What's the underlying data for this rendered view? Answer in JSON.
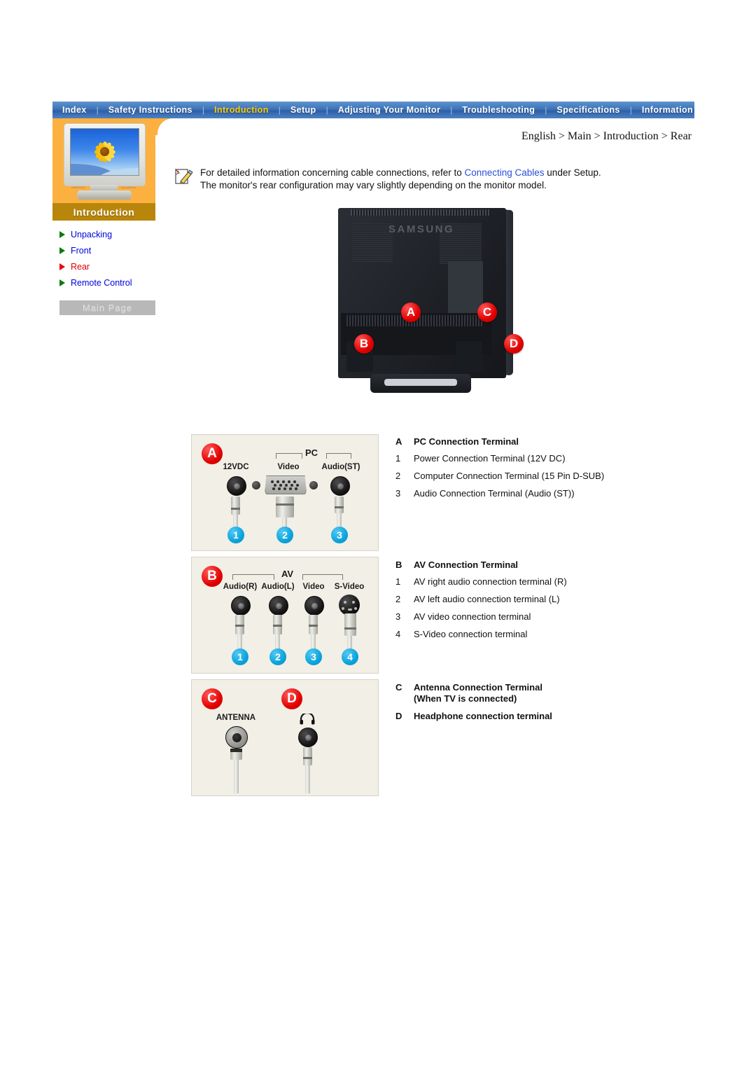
{
  "nav": {
    "items": [
      {
        "label": "Index",
        "active": false
      },
      {
        "label": "Safety Instructions",
        "active": false
      },
      {
        "label": "Introduction",
        "active": true
      },
      {
        "label": "Setup",
        "active": false
      },
      {
        "label": "Adjusting Your Monitor",
        "active": false
      },
      {
        "label": "Troubleshooting",
        "active": false
      },
      {
        "label": "Specifications",
        "active": false
      },
      {
        "label": "Information",
        "active": false
      }
    ],
    "separator": "|"
  },
  "sidebar": {
    "title": "Introduction",
    "thumbnail_brand": "SAMSUNG",
    "thumbnail_model": "SyncMaster",
    "items": [
      {
        "label": "Unpacking",
        "current": false
      },
      {
        "label": "Front",
        "current": false
      },
      {
        "label": "Rear",
        "current": true
      },
      {
        "label": "Remote Control",
        "current": false
      }
    ],
    "main_page_button": "Main Page"
  },
  "breadcrumb": "English > Main > Introduction > Rear",
  "note": {
    "line1_before": "For detailed information concerning cable connections, refer to ",
    "line1_link": "Connecting Cables",
    "line1_after": " under Setup.",
    "line2": "The monitor's rear configuration may vary slightly depending on the monitor model."
  },
  "monitor_photo": {
    "brand": "SAMSUNG",
    "markers": [
      "A",
      "B",
      "C",
      "D"
    ]
  },
  "panels": [
    {
      "id": "A",
      "marker": "A",
      "group_label": "PC",
      "jacks": [
        "12VDC",
        "Video",
        "Audio(ST)"
      ],
      "numbers": [
        "1",
        "2",
        "3"
      ]
    },
    {
      "id": "B",
      "marker": "B",
      "group_label": "AV",
      "jacks": [
        "Audio(R)",
        "Audio(L)",
        "Video",
        "S-Video"
      ],
      "numbers": [
        "1",
        "2",
        "3",
        "4"
      ]
    },
    {
      "id": "C",
      "markers": [
        "C",
        "D"
      ],
      "jacks": [
        "ANTENNA"
      ],
      "headphone_icon": "headphone-icon"
    }
  ],
  "descriptions": {
    "A": {
      "key": "A",
      "title": "PC Connection Terminal",
      "rows": [
        {
          "k": "1",
          "t": "Power Connection Terminal (12V DC)"
        },
        {
          "k": "2",
          "t": "Computer Connection Terminal (15 Pin D-SUB)"
        },
        {
          "k": "3",
          "t": "Audio Connection Terminal (Audio (ST))"
        }
      ]
    },
    "B": {
      "key": "B",
      "title": "AV Connection Terminal",
      "rows": [
        {
          "k": "1",
          "t": "AV right audio connection terminal (R)"
        },
        {
          "k": "2",
          "t": "AV left audio connection terminal (L)"
        },
        {
          "k": "3",
          "t": "AV video connection terminal"
        },
        {
          "k": "4",
          "t": "S-Video connection terminal"
        }
      ]
    },
    "C": {
      "rows": [
        {
          "k": "C",
          "t": "Antenna Connection Terminal",
          "t2": "(When TV is connected)"
        },
        {
          "k": "D",
          "t": "Headphone connection terminal"
        }
      ]
    }
  },
  "colors": {
    "nav_blue": "#3d74b8",
    "nav_active": "#ffcc00",
    "sidebar_orange": "#fcb040",
    "sidebar_title_brown": "#b8860b",
    "link_blue": "#0000dd",
    "current_red": "#dd0000",
    "marker_red": "#e20000",
    "number_cyan": "#0aa3dd",
    "panel_bg": "#f1efe6"
  }
}
